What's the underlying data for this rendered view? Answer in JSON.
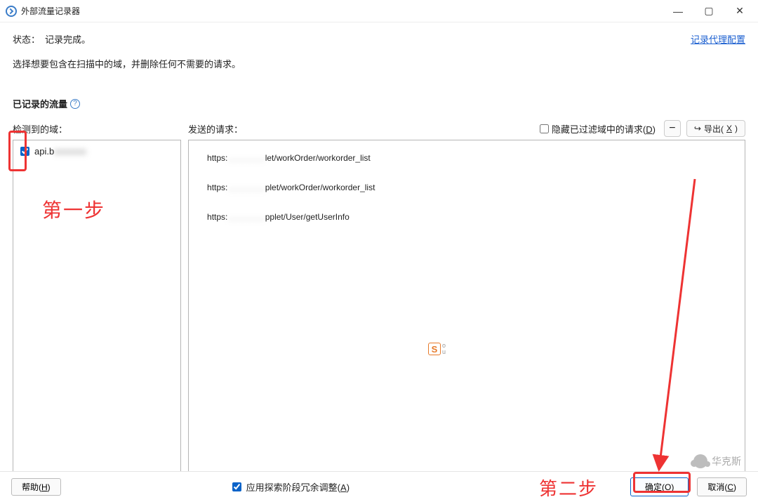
{
  "window": {
    "title": "外部流量记录器"
  },
  "header": {
    "status_label": "状态：",
    "status_value": "记录完成。",
    "config_link": "记录代理配置",
    "instruction": "选择想要包含在扫描中的域，并删除任何不需要的请求。"
  },
  "section": {
    "title": "已记录的流量"
  },
  "controls": {
    "left_col_label": "检测到的域：",
    "right_col_label": "发送的请求：",
    "hide_filtered_prefix": "隐藏已过滤域中的请求(",
    "hide_filtered_key": "D",
    "hide_filtered_suffix": ")",
    "minus": "−",
    "export_prefix": "导出(",
    "export_key": "X",
    "export_suffix": ")"
  },
  "domains": [
    {
      "checked": true,
      "text": "api.b"
    }
  ],
  "requests": [
    {
      "prefix": "https:",
      "obscured": "................",
      "suffix": "let/workOrder/workorder_list"
    },
    {
      "prefix": "https:",
      "obscured": "................",
      "suffix": "plet/workOrder/workorder_list"
    },
    {
      "prefix": "https:",
      "obscured": "................",
      "suffix": "pplet/User/getUserInfo"
    }
  ],
  "bottom": {
    "help_prefix": "帮助(",
    "help_key": "H",
    "help_suffix": ")",
    "adjust_prefix": "应用探索阶段冗余调整(",
    "adjust_key": "A",
    "adjust_suffix": ")",
    "ok_prefix": "确定(",
    "ok_key": "O",
    "ok_suffix": ")",
    "cancel_prefix": "取消(",
    "cancel_key": "C",
    "cancel_suffix": ")"
  },
  "annotations": {
    "step1": "第一步",
    "step2": "第二步"
  },
  "ime": {
    "s": "S",
    "stack1": "o",
    "stack2": "u"
  },
  "watermark": "华克斯"
}
